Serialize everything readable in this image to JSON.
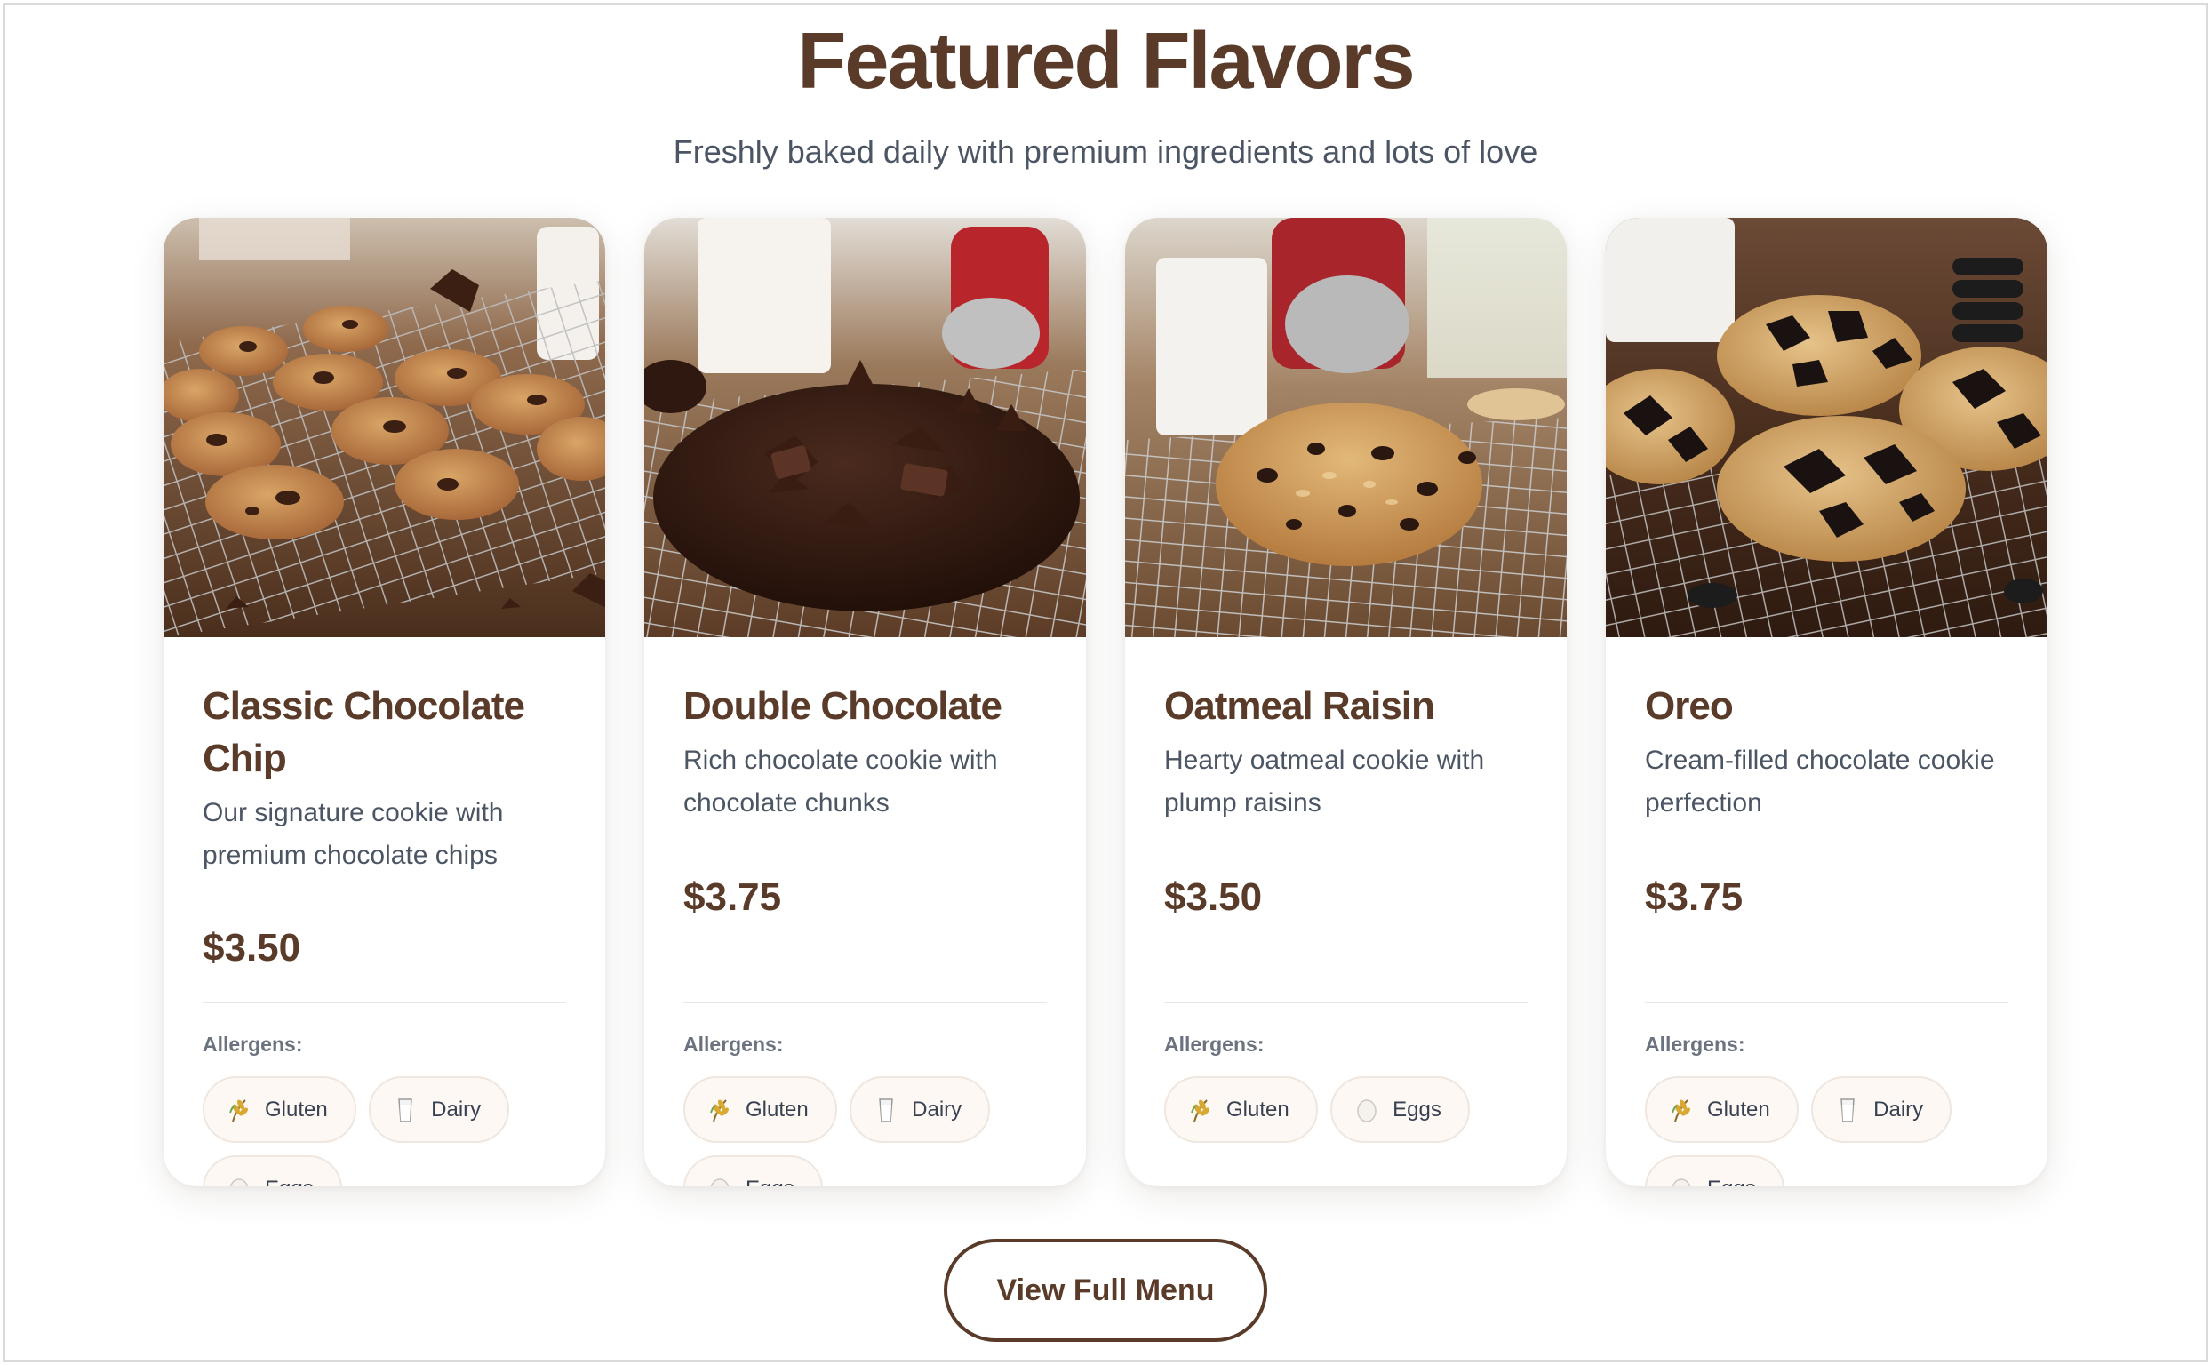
{
  "section": {
    "title": "Featured Flavors",
    "subtitle": "Freshly baked daily with premium ingredients and lots of love"
  },
  "allergens_label": "Allergens:",
  "cards": [
    {
      "name": "Classic Chocolate Chip",
      "description": "Our signature cookie with premium chocolate chips",
      "price": "$3.50",
      "allergens": [
        {
          "label": "Gluten",
          "icon": "wheat-icon"
        },
        {
          "label": "Dairy",
          "icon": "milk-glass-icon"
        },
        {
          "label": "Eggs",
          "icon": "egg-icon"
        }
      ]
    },
    {
      "name": "Double Chocolate",
      "description": "Rich chocolate cookie with chocolate chunks",
      "price": "$3.75",
      "allergens": [
        {
          "label": "Gluten",
          "icon": "wheat-icon"
        },
        {
          "label": "Dairy",
          "icon": "milk-glass-icon"
        },
        {
          "label": "Eggs",
          "icon": "egg-icon"
        }
      ]
    },
    {
      "name": "Oatmeal Raisin",
      "description": "Hearty oatmeal cookie with plump raisins",
      "price": "$3.50",
      "allergens": [
        {
          "label": "Gluten",
          "icon": "wheat-icon"
        },
        {
          "label": "Eggs",
          "icon": "egg-icon"
        }
      ]
    },
    {
      "name": "Oreo",
      "description": "Cream-filled chocolate cookie perfection",
      "price": "$3.75",
      "allergens": [
        {
          "label": "Gluten",
          "icon": "wheat-icon"
        },
        {
          "label": "Dairy",
          "icon": "milk-glass-icon"
        },
        {
          "label": "Eggs",
          "icon": "egg-icon"
        }
      ]
    }
  ],
  "cta": {
    "label": "View Full Menu"
  },
  "colors": {
    "brand_brown": "#5a3a28",
    "body_text": "#4b5563",
    "chip_bg": "#fdf8f4"
  }
}
